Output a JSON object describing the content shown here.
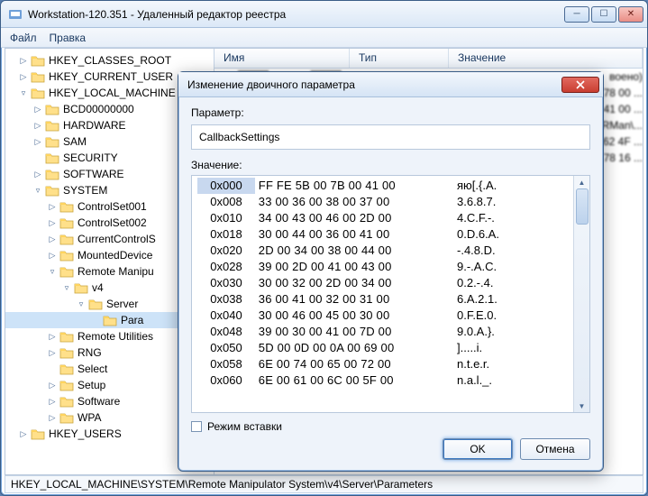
{
  "window": {
    "title": "Workstation-120.351 - Удаленный редактор реестра"
  },
  "menu": {
    "file": "Файл",
    "edit": "Правка"
  },
  "tree": [
    {
      "ind": 1,
      "twist": "▷",
      "label": "HKEY_CLASSES_ROOT"
    },
    {
      "ind": 1,
      "twist": "▷",
      "label": "HKEY_CURRENT_USER"
    },
    {
      "ind": 1,
      "twist": "▿",
      "label": "HKEY_LOCAL_MACHINE"
    },
    {
      "ind": 2,
      "twist": "▷",
      "label": "BCD00000000"
    },
    {
      "ind": 2,
      "twist": "▷",
      "label": "HARDWARE"
    },
    {
      "ind": 2,
      "twist": "▷",
      "label": "SAM"
    },
    {
      "ind": 2,
      "twist": " ",
      "label": "SECURITY"
    },
    {
      "ind": 2,
      "twist": "▷",
      "label": "SOFTWARE"
    },
    {
      "ind": 2,
      "twist": "▿",
      "label": "SYSTEM"
    },
    {
      "ind": 3,
      "twist": "▷",
      "label": "ControlSet001"
    },
    {
      "ind": 3,
      "twist": "▷",
      "label": "ControlSet002"
    },
    {
      "ind": 3,
      "twist": "▷",
      "label": "CurrentControlS"
    },
    {
      "ind": 3,
      "twist": "▷",
      "label": "MountedDevice"
    },
    {
      "ind": 3,
      "twist": "▿",
      "label": "Remote Manipu"
    },
    {
      "ind": 4,
      "twist": "▿",
      "label": "v4"
    },
    {
      "ind": 5,
      "twist": "▿",
      "label": "Server"
    },
    {
      "ind": 6,
      "twist": " ",
      "label": "Para",
      "sel": true
    },
    {
      "ind": 3,
      "twist": "▷",
      "label": "Remote Utilities"
    },
    {
      "ind": 3,
      "twist": "▷",
      "label": "RNG"
    },
    {
      "ind": 3,
      "twist": " ",
      "label": "Select"
    },
    {
      "ind": 3,
      "twist": "▷",
      "label": "Setup"
    },
    {
      "ind": 3,
      "twist": "▷",
      "label": "Software"
    },
    {
      "ind": 3,
      "twist": "▷",
      "label": "WPA"
    },
    {
      "ind": 1,
      "twist": "▷",
      "label": "HKEY_USERS"
    }
  ],
  "columns": {
    "name": "Имя",
    "type": "Тип",
    "value": "Значение"
  },
  "valuesPreview": [
    {
      "tail": "воено)"
    },
    {
      "tail": "78 00 ..."
    },
    {
      "tail": "41 00 ..."
    },
    {
      "tail": "RMan\\..."
    },
    {
      "tail": "62 4F ..."
    },
    {
      "tail": "78 16 ..."
    }
  ],
  "dialog": {
    "title": "Изменение двоичного параметра",
    "paramLabel": "Параметр:",
    "paramName": "CallbackSettings",
    "valueLabel": "Значение:",
    "insertMode": "Режим вставки",
    "ok": "OK",
    "cancel": "Отмена"
  },
  "hex": [
    {
      "off": "0x000",
      "b": "FF FE 5B 00 7B 00 41 00",
      "a": "яю[.{.A.",
      "sel": true
    },
    {
      "off": "0x008",
      "b": "33 00 36 00 38 00 37 00",
      "a": "3.6.8.7."
    },
    {
      "off": "0x010",
      "b": "34 00 43 00 46 00 2D 00",
      "a": "4.C.F.-."
    },
    {
      "off": "0x018",
      "b": "30 00 44 00 36 00 41 00",
      "a": "0.D.6.A."
    },
    {
      "off": "0x020",
      "b": "2D 00 34 00 38 00 44 00",
      "a": "-.4.8.D."
    },
    {
      "off": "0x028",
      "b": "39 00 2D 00 41 00 43 00",
      "a": "9.-.A.C."
    },
    {
      "off": "0x030",
      "b": "30 00 32 00 2D 00 34 00",
      "a": "0.2.-.4."
    },
    {
      "off": "0x038",
      "b": "36 00 41 00 32 00 31 00",
      "a": "6.A.2.1."
    },
    {
      "off": "0x040",
      "b": "30 00 46 00 45 00 30 00",
      "a": "0.F.E.0."
    },
    {
      "off": "0x048",
      "b": "39 00 30 00 41 00 7D 00",
      "a": "9.0.A.}."
    },
    {
      "off": "0x050",
      "b": "5D 00 0D 00 0A 00 69 00",
      "a": "].....i."
    },
    {
      "off": "0x058",
      "b": "6E 00 74 00 65 00 72 00",
      "a": "n.t.e.r."
    },
    {
      "off": "0x060",
      "b": "6E 00 61 00 6C 00 5F 00",
      "a": "n.a.l._."
    }
  ],
  "statusbar": "HKEY_LOCAL_MACHINE\\SYSTEM\\Remote Manipulator System\\v4\\Server\\Parameters"
}
